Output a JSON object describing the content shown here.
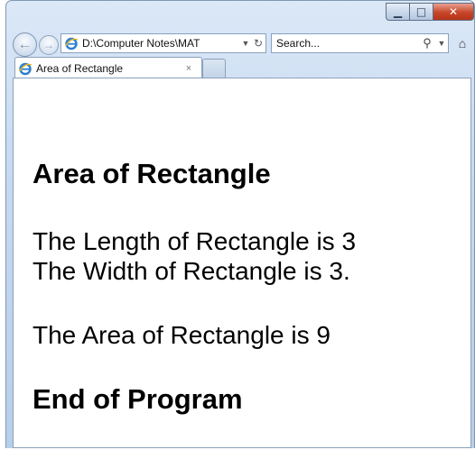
{
  "toolbar": {
    "address": "D:\\Computer Notes\\MAT",
    "search_placeholder": "Search..."
  },
  "tab": {
    "label": "Area of Rectangle",
    "close": "×"
  },
  "content": {
    "heading": "Area of Rectangle",
    "length_line": "The Length of Rectangle is 3",
    "width_line": "The Width of Rectangle is 3.",
    "area_line": "The Area of Rectangle is 9",
    "end_heading": "End of Program"
  }
}
